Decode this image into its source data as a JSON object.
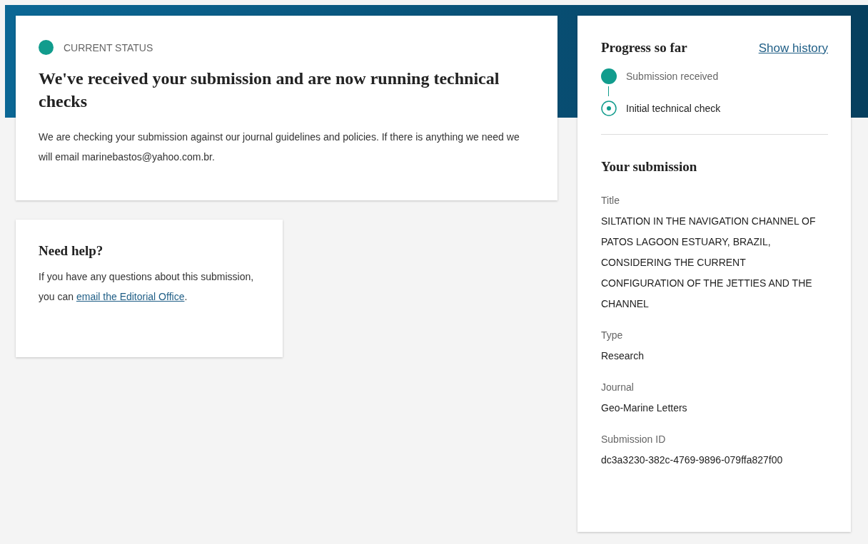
{
  "status": {
    "label": "CURRENT STATUS",
    "heading": "We've received your submission and are now running technical checks",
    "message": "We are checking your submission against our journal guidelines and policies. If there is anything we need we will email marinebastos@yahoo.com.br."
  },
  "help": {
    "heading": "Need help?",
    "text_before": "If you have any questions about this submission, you can ",
    "link": "email the Editorial Office",
    "text_after": "."
  },
  "progress": {
    "heading": "Progress so far",
    "history_link": "Show history",
    "steps": [
      {
        "label": "Submission received",
        "kind": "completed"
      },
      {
        "label": "Initial technical check",
        "kind": "current"
      }
    ]
  },
  "submission": {
    "heading": "Your submission",
    "fields": [
      {
        "label": "Title",
        "value": "SILTATION IN THE NAVIGATION CHANNEL OF PATOS LAGOON ESTUARY, BRAZIL, CONSIDERING THE CURRENT CONFIGURATION OF THE JETTIES AND THE CHANNEL"
      },
      {
        "label": "Type",
        "value": "Research"
      },
      {
        "label": "Journal",
        "value": "Geo-Marine Letters"
      },
      {
        "label": "Submission ID",
        "value": "dc3a3230-382c-4769-9896-079ffa827f00"
      }
    ]
  }
}
